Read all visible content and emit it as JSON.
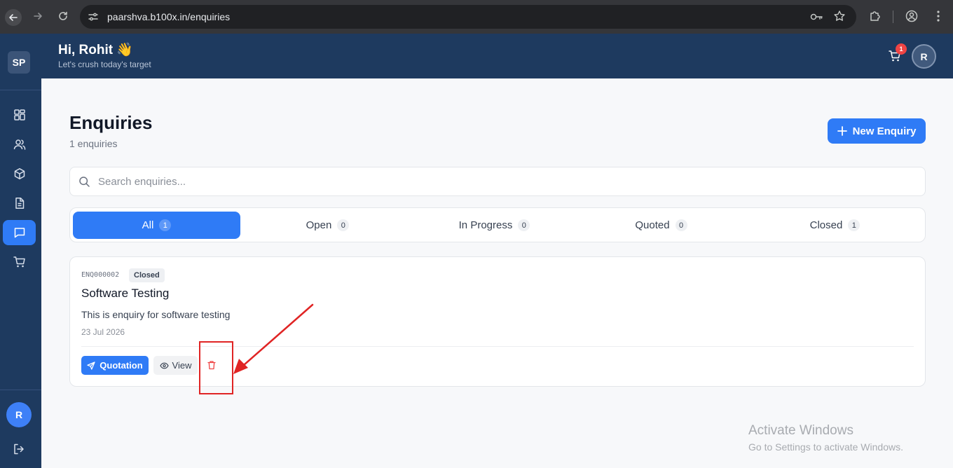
{
  "browser": {
    "url": "paarshva.b100x.in/enquiries"
  },
  "sidebar": {
    "logo": "SP",
    "items": [
      {
        "icon": "dashboard-icon"
      },
      {
        "icon": "users-icon"
      },
      {
        "icon": "box-icon"
      },
      {
        "icon": "document-icon"
      },
      {
        "icon": "chat-icon",
        "active": true
      },
      {
        "icon": "cart-icon"
      }
    ],
    "avatar": "R"
  },
  "header": {
    "greeting": "Hi, Rohit 👋",
    "subtitle": "Let's crush today's target",
    "cart_count": "1",
    "avatar": "R"
  },
  "page": {
    "title": "Enquiries",
    "count_text": "1 enquiries",
    "new_button": "New Enquiry",
    "search_placeholder": "Search enquiries..."
  },
  "tabs": [
    {
      "label": "All",
      "count": "1",
      "active": true
    },
    {
      "label": "Open",
      "count": "0"
    },
    {
      "label": "In Progress",
      "count": "0"
    },
    {
      "label": "Quoted",
      "count": "0"
    },
    {
      "label": "Closed",
      "count": "1"
    }
  ],
  "enquiry": {
    "code": "ENQ000002",
    "status": "Closed",
    "title": "Software Testing",
    "description": "This is enquiry for software testing",
    "date": "23 Jul 2026",
    "quotation_label": "Quotation",
    "view_label": "View"
  },
  "watermark": {
    "title": "Activate Windows",
    "subtitle": "Go to Settings to activate Windows."
  },
  "colors": {
    "primary": "#2f7bf6",
    "navy": "#1e3a5f",
    "danger": "#ef4444",
    "annotation": "#e02424"
  }
}
